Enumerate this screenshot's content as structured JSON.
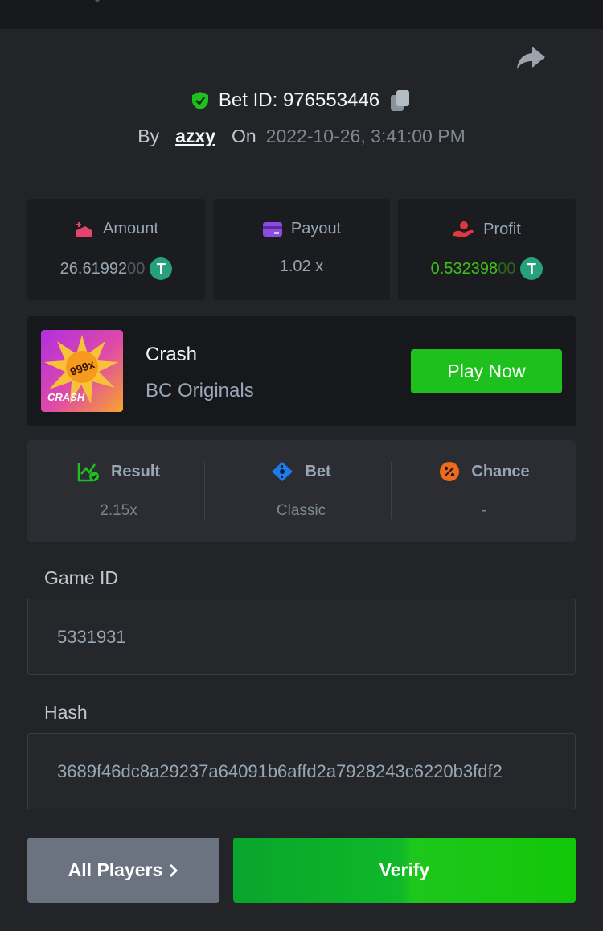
{
  "header": {
    "bet_id_label": "Bet ID: 976553446",
    "by_label": "By",
    "username": "azxy",
    "on_label": "On",
    "datetime": "2022-10-26, 3:41:00 PM"
  },
  "stats": {
    "amount": {
      "label": "Amount",
      "value_main": "26.61992",
      "value_trail": "00",
      "currency_icon": "usdt-icon"
    },
    "payout": {
      "label": "Payout",
      "value": "1.02 x"
    },
    "profit": {
      "label": "Profit",
      "value_main": "0.532398",
      "value_trail": "00",
      "currency_icon": "usdt-icon"
    }
  },
  "game": {
    "thumb_badge": "999x",
    "thumb_title": "CRASH",
    "name": "Crash",
    "provider": "BC Originals",
    "play_label": "Play Now"
  },
  "info": {
    "result": {
      "label": "Result",
      "value": "2.15x"
    },
    "bet": {
      "label": "Bet",
      "value": "Classic"
    },
    "chance": {
      "label": "Chance",
      "value": "-"
    }
  },
  "fields": {
    "game_id": {
      "label": "Game ID",
      "value": "5331931"
    },
    "hash": {
      "label": "Hash",
      "value": "3689f46dc8a29237a64091b6affd2a7928243c6220b3fdf2"
    }
  },
  "actions": {
    "all_players_label": "All Players",
    "verify_label": "Verify"
  },
  "colors": {
    "accent_green": "#1ec01e",
    "profit_green": "#3bc117",
    "usdt": "#26a17b"
  }
}
